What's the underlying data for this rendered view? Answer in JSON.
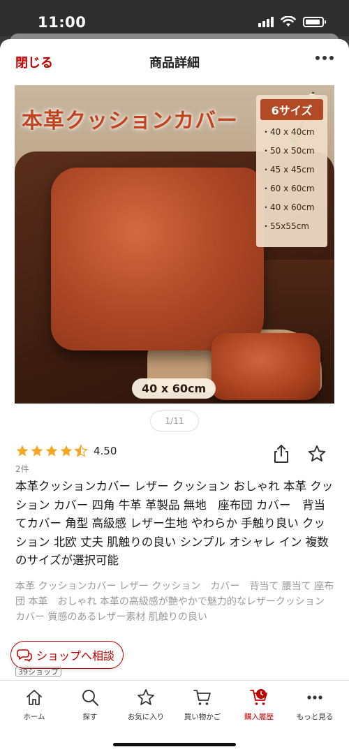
{
  "status_bar": {
    "time": "11:00"
  },
  "header": {
    "close_label": "閉じる",
    "title": "商品詳細"
  },
  "image": {
    "title": "本革クッションカバー",
    "sizes_heading": "6サイズ",
    "sizes": [
      "・40 x 40cm",
      "・50 x 50cm",
      "・45 x 45cm",
      "・60 x 60cm",
      "・40 x 60cm",
      "・55x55cm"
    ],
    "size_tag": "40 x 60cm",
    "pager": "1/11"
  },
  "rating": {
    "value": "4.50",
    "stars": 4.5,
    "reviews": "2件"
  },
  "product": {
    "title": "本革クッションカバー レザー クッション おしゃれ 本革 クッション カバー 四角 牛革 革製品 無地　座布団 カバー　背当てカバー 角型 高級感 レザー生地 やわらか 手触り良い クッション 北欧 丈夫 肌触りの良い シンプル オシャレ イン 複数のサイズが選択可能",
    "description": "本革 クッションカバー レザー クッション　カバー　背当て 腰当て 座布団 本革　おしゃれ 本革の高級感が艶やかで魅力的なレザークッション カバー 質感のあるレザー素材 肌触りの良い"
  },
  "consult_button": {
    "label": "ショップへ相談"
  },
  "shop_badge": "39ショップ",
  "bottom_nav": [
    {
      "label": "ホーム",
      "icon": "home-icon"
    },
    {
      "label": "探す",
      "icon": "search-icon"
    },
    {
      "label": "お気に入り",
      "icon": "star-icon"
    },
    {
      "label": "買い物かご",
      "icon": "cart-icon"
    },
    {
      "label": "購入履歴",
      "icon": "purchase-history-icon"
    },
    {
      "label": "もっと見る",
      "icon": "more-icon"
    }
  ],
  "colors": {
    "accent": "#bf0000",
    "star": "#f5a623"
  }
}
